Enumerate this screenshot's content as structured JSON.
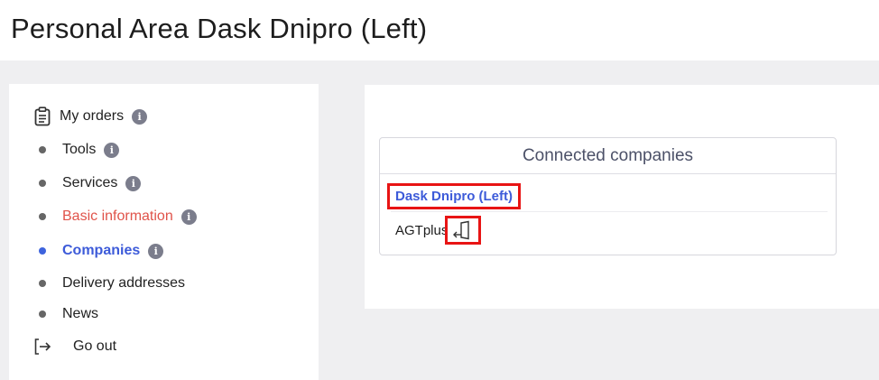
{
  "page": {
    "title": "Personal Area Dask Dnipro (Left)"
  },
  "sidebar": {
    "items": [
      {
        "label": "My orders",
        "info": "i"
      },
      {
        "label": "Tools",
        "info": "i"
      },
      {
        "label": "Services",
        "info": "i"
      },
      {
        "label": "Basic information",
        "info": "i"
      },
      {
        "label": "Companies",
        "info": "i"
      },
      {
        "label": "Delivery addresses"
      },
      {
        "label": "News"
      },
      {
        "label": "Go out"
      }
    ]
  },
  "companies": {
    "heading": "Connected companies",
    "current": "Dask Dnipro (Left)",
    "other": "AGTplus"
  },
  "colors": {
    "accent": "#3d5bd9",
    "highlight": "#e0534a",
    "annotation": "#e81414",
    "background": "#efeff1"
  }
}
